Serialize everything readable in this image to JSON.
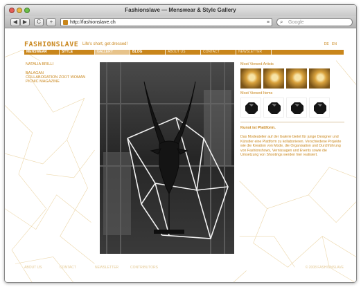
{
  "window": {
    "title": "Fashionslave — Menswear & Style Gallery",
    "url": "http://fashionslave.ch",
    "search_placeholder": "Google"
  },
  "toolbar": {
    "back": "◀",
    "forward": "▶",
    "reload": "C",
    "add": "+"
  },
  "header": {
    "logo": "FASHIONSLAVE",
    "slogan": "Life's short, get dressed!",
    "lang": [
      "DE",
      "EN"
    ]
  },
  "nav": [
    "MENSWEAR",
    "STYLE",
    "GALLERY",
    "BLOG",
    "ABOUT US",
    "CONTACT",
    "NEWSLETTER"
  ],
  "sidebar": {
    "artist": "NATALIA BRILLI",
    "links": [
      "BALAGAN",
      "COLLABORATION ZOOT WOMAN",
      "PICNIC MAGAZINE"
    ]
  },
  "right": {
    "artists_title": "Most Viewed Artists",
    "items_title": "Most Viewed Items",
    "art_title": "Kunst ist Plattform.",
    "art_text": "Das Modeatelier auf der Galerie bietet für junge Designer und Künstler eine Plattform zu kollaborieren. Verschiedene Projekte wie die Kreation von Mode, die Organisation und Durchführung von Fashionshows, Vernissagen und Events sowie die Umsetzung von Shootings werden hier realisiert."
  },
  "footer": {
    "links": [
      "ABOUT US",
      "CONTACT",
      "NEWSLETTER",
      "CONTRIBUTORS"
    ],
    "copyright": "© 2008 FASHIONSLAVE"
  },
  "colors": {
    "accent": "#c9861b",
    "chrome": "#c9c9c9"
  },
  "icons": {
    "back": "back-arrow-icon",
    "forward": "forward-arrow-icon",
    "reload": "reload-icon",
    "add": "add-bookmark-icon",
    "search": "search-icon"
  }
}
